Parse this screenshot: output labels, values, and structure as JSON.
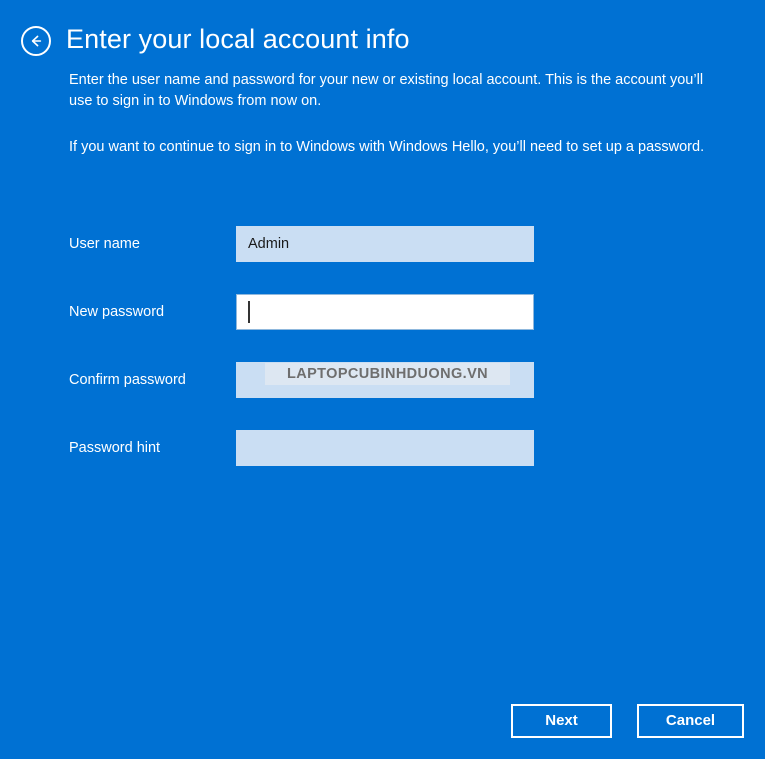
{
  "window": {
    "background_color": "#0071d3",
    "text_color": "#ffffff"
  },
  "header": {
    "back_icon": "back-arrow-icon",
    "title": "Enter your local account info"
  },
  "intro": {
    "paragraph_1": "Enter the user name and password for your new or existing local account. This is the account you’ll use to sign in to Windows from now on.",
    "paragraph_2": "If you want to continue to sign in to Windows with Windows Hello, you’ll need to set up a password."
  },
  "form": {
    "fields": [
      {
        "label": "User name",
        "value": "Admin",
        "placeholder": "",
        "focused": false,
        "type": "text"
      },
      {
        "label": "New password",
        "value": "",
        "placeholder": "",
        "focused": true,
        "type": "password"
      },
      {
        "label": "Confirm password",
        "value": "",
        "placeholder": "",
        "focused": false,
        "type": "password"
      },
      {
        "label": "Password hint",
        "value": "",
        "placeholder": "",
        "focused": false,
        "type": "text"
      }
    ],
    "input_background": "#cadef3",
    "input_focused_background": "#ffffff"
  },
  "watermark": {
    "text": "LAPTOPCUBINHDUONG.VN",
    "color": "#6e6e6e",
    "background": "#dde7f2"
  },
  "footer": {
    "next_label": "Next",
    "cancel_label": "Cancel"
  }
}
